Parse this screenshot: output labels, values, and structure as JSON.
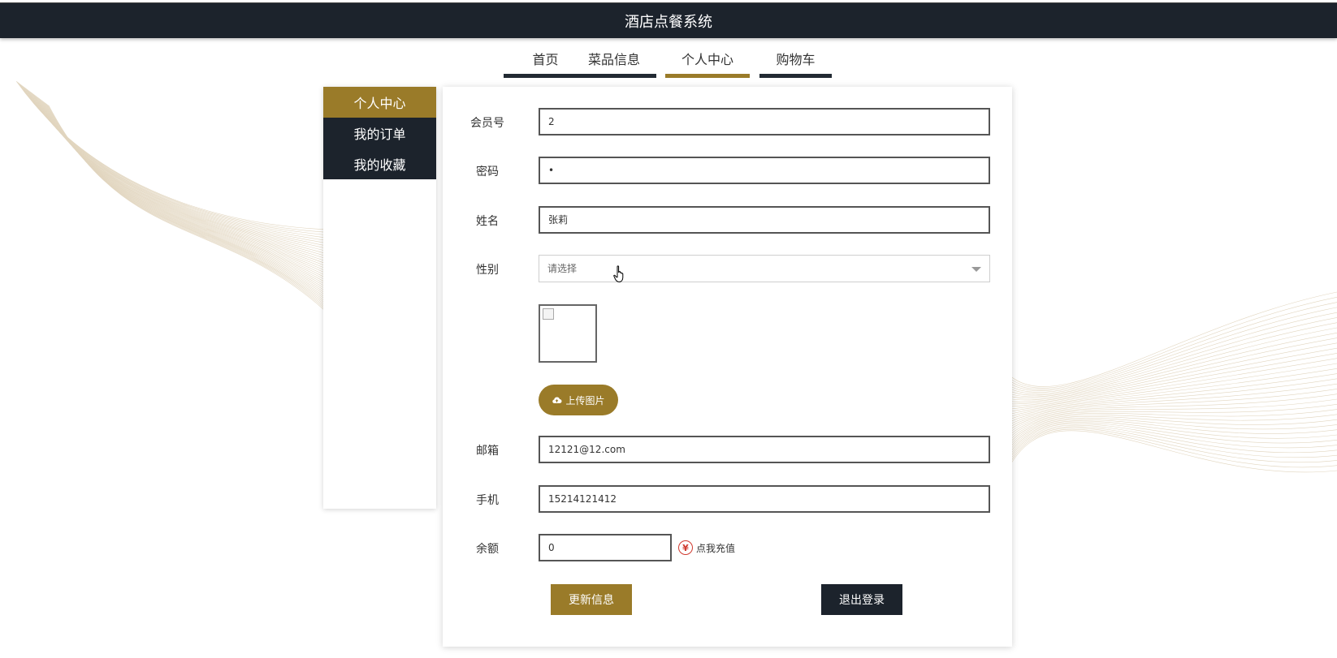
{
  "header": {
    "title": "酒店点餐系统"
  },
  "nav": {
    "items": [
      {
        "label": "首页",
        "active": false
      },
      {
        "label": "菜品信息",
        "active": false
      },
      {
        "label": "个人中心",
        "active": true
      },
      {
        "label": "购物车",
        "active": false
      }
    ]
  },
  "sidebar": {
    "items": [
      {
        "label": "个人中心",
        "active": true
      },
      {
        "label": "我的订单",
        "active": false
      },
      {
        "label": "我的收藏",
        "active": false
      }
    ]
  },
  "form": {
    "member_id": {
      "label": "会员号",
      "value": "2"
    },
    "password": {
      "label": "密码",
      "value": "•"
    },
    "name": {
      "label": "姓名",
      "value": "张莉"
    },
    "gender": {
      "label": "性别",
      "placeholder": "请选择"
    },
    "upload": {
      "label": "上传图片"
    },
    "email": {
      "label": "邮箱",
      "value": "12121@12.com"
    },
    "phone": {
      "label": "手机",
      "value": "15214121412"
    },
    "balance": {
      "label": "余额",
      "value": "0",
      "recharge_label": "点我充值",
      "currency_symbol": "¥"
    }
  },
  "actions": {
    "update_label": "更新信息",
    "logout_label": "退出登录"
  },
  "colors": {
    "accent": "#9a7b29",
    "dark": "#1c232c",
    "recharge_red": "#d03a2f"
  }
}
